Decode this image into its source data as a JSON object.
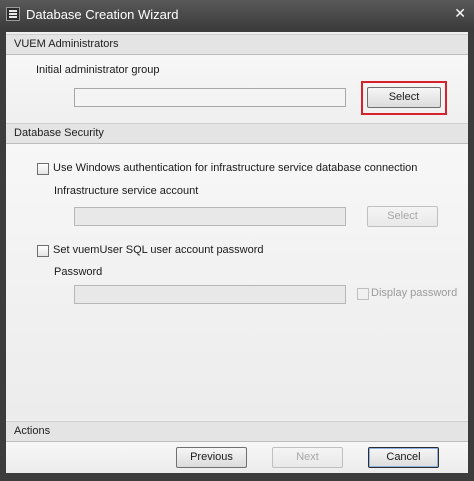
{
  "window": {
    "title": "Database Creation Wizard",
    "close_glyph": "✕"
  },
  "vuem_admins": {
    "header": "VUEM Administrators",
    "group_label": "Initial administrator group",
    "group_value": "",
    "select_label": "Select"
  },
  "db_security": {
    "header": "Database Security",
    "windows_auth_label": "Use Windows authentication for infrastructure service database connection",
    "windows_auth_checked": false,
    "service_account_label": "Infrastructure service account",
    "service_account_value": "",
    "service_select_label": "Select",
    "set_password_label": "Set vuemUser SQL user account password",
    "set_password_checked": false,
    "password_label": "Password",
    "password_value": "",
    "display_password_label": "Display password",
    "display_password_checked": false
  },
  "actions": {
    "header": "Actions",
    "previous_label": "Previous",
    "next_label": "Next",
    "cancel_label": "Cancel"
  },
  "colors": {
    "highlight": "#d6222a",
    "titlebar": "#4a4a4a"
  }
}
